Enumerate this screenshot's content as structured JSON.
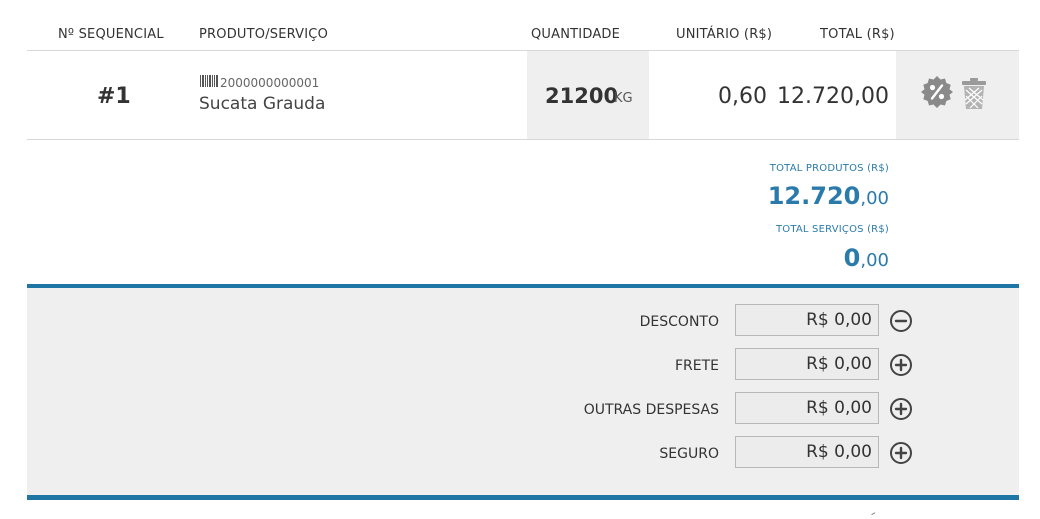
{
  "header": {
    "seq": "Nº SEQUENCIAL",
    "product": "PRODUTO/SERVIÇO",
    "quantity": "QUANTIDADE",
    "unit_price": "UNITÁRIO (R$)",
    "total": "TOTAL (R$)"
  },
  "item": {
    "seq": "#1",
    "barcode": "2000000000001",
    "name": "Sucata Grauda",
    "quantity": "21200",
    "unit": "KG",
    "unit_price": "0,60",
    "total": "12.720,00",
    "icons": [
      "discount-badge-icon",
      "trash-icon"
    ]
  },
  "totals": {
    "products_label": "TOTAL PRODUTOS (R$)",
    "products_int": "12.720",
    "products_dec": ",00",
    "services_label": "TOTAL SERVIÇOS (R$)",
    "services_int": "0",
    "services_dec": ",00",
    "color": "#2a7bab"
  },
  "adjustments": {
    "desconto_label": "DESCONTO",
    "desconto_value": "R$ 0,00",
    "frete_label": "FRETE",
    "frete_value": "R$ 0,00",
    "outras_label": "OUTRAS DESPESAS",
    "outras_value": "R$ 0,00",
    "seguro_label": "SEGURO",
    "seguro_value": "R$ 0,00",
    "icons": [
      "minus-circle-icon",
      "plus-circle-icon"
    ]
  },
  "colors": {
    "accent": "#1d76a3",
    "panel_bg": "#efefef"
  }
}
